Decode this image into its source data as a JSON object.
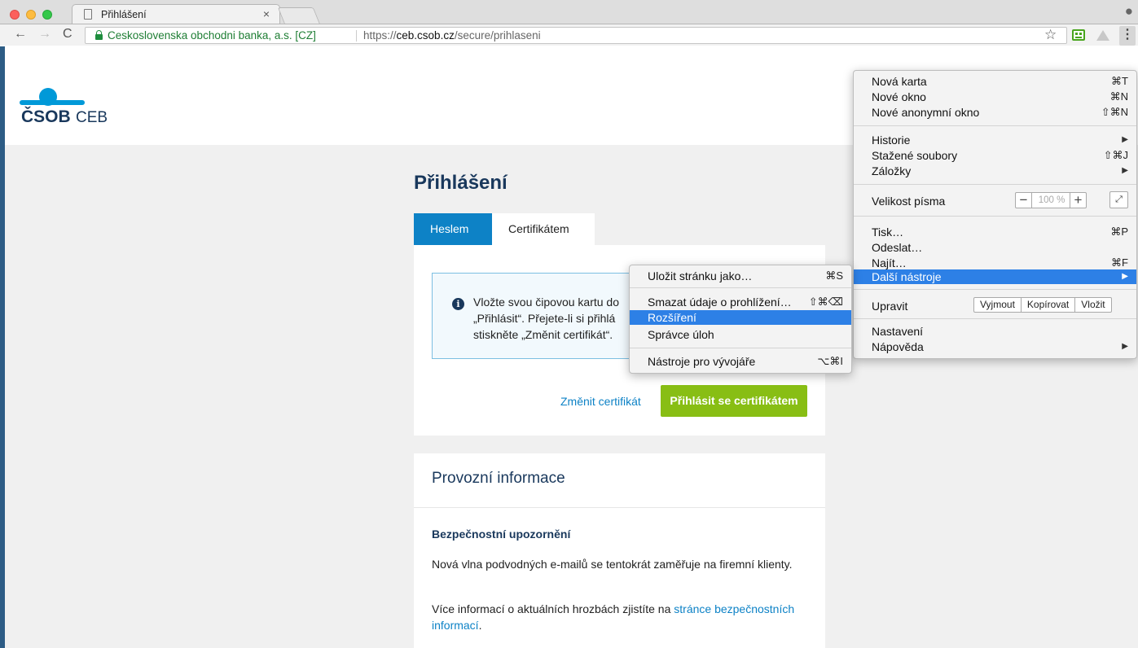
{
  "browser": {
    "tab_title": "Přihlášení",
    "tab_close": "×",
    "org_name": "Ceskoslovenska obchodni banka, a.s. [CZ]",
    "url_scheme": "https://",
    "url_host": "ceb.csob.cz",
    "url_path": "/secure/prihlaseni",
    "nav_back": "←",
    "nav_forward": "→",
    "nav_reload": "C",
    "star": "☆",
    "menu_button": "⋮",
    "profile": "⍤"
  },
  "logo": {
    "brand": "ČSOB",
    "product": "CEB"
  },
  "login": {
    "title": "Přihlášení",
    "tabs": [
      {
        "label": "Heslem"
      },
      {
        "label": "Certifikátem"
      }
    ],
    "info_icon": "i",
    "info_line1": "Vložte svou čipovou kartu do",
    "info_line2": "„Přihlásit“. Přejete-li si přihlá",
    "info_line3": "stiskněte „Změnit certifikát“.",
    "change_link": "Změnit certifikát",
    "submit_button": "Přihlásit se certifikátem"
  },
  "operational": {
    "title": "Provozní informace",
    "heading": "Bezpečnostní upozornění",
    "p1": "Nová vlna podvodných e-mailů se tentokrát zaměřuje na firemní klienty.",
    "p2_prefix": "Více informací o aktuálních hrozbách zjistíte na ",
    "p2_link": "stránce bezpečnostních informací",
    "p2_suffix": "."
  },
  "main_menu": {
    "items": [
      {
        "label": "Nová karta",
        "shortcut": "⌘T"
      },
      {
        "label": "Nové okno",
        "shortcut": "⌘N"
      },
      {
        "label": "Nové anonymní okno",
        "shortcut": "⇧⌘N"
      },
      {
        "label": "Historie",
        "arrow": "▶"
      },
      {
        "label": "Stažené soubory",
        "shortcut": "⇧⌘J"
      },
      {
        "label": "Záložky",
        "arrow": "▶"
      },
      {
        "label": "Velikost písma"
      },
      {
        "label": "Tisk…",
        "shortcut": "⌘P"
      },
      {
        "label": "Odeslat…"
      },
      {
        "label": "Najít…",
        "shortcut": "⌘F"
      },
      {
        "label": "Další nástroje",
        "arrow": "▶"
      },
      {
        "label": "Upravit"
      },
      {
        "label": "Nastavení"
      },
      {
        "label": "Nápověda",
        "arrow": "▶"
      }
    ],
    "zoom": {
      "minus": "−",
      "value": "100 %",
      "plus": "+",
      "fullscreen": "⤢"
    },
    "edit": {
      "cut": "Vyjmout",
      "copy": "Kopírovat",
      "paste": "Vložit"
    }
  },
  "sub_menu": {
    "items": [
      {
        "label": "Uložit stránku jako…",
        "shortcut": "⌘S"
      },
      {
        "label": "Smazat údaje o prohlížení…",
        "shortcut": "⇧⌘⌫"
      },
      {
        "label": "Rozšíření"
      },
      {
        "label": "Správce úloh"
      },
      {
        "label": "Nástroje pro vývojáře",
        "shortcut": "⌥⌘I"
      }
    ]
  },
  "colors": {
    "accent_blue": "#0d82c6",
    "brand_navy": "#19385c",
    "button_green": "#88be14",
    "menu_highlight": "#2d80e6"
  }
}
